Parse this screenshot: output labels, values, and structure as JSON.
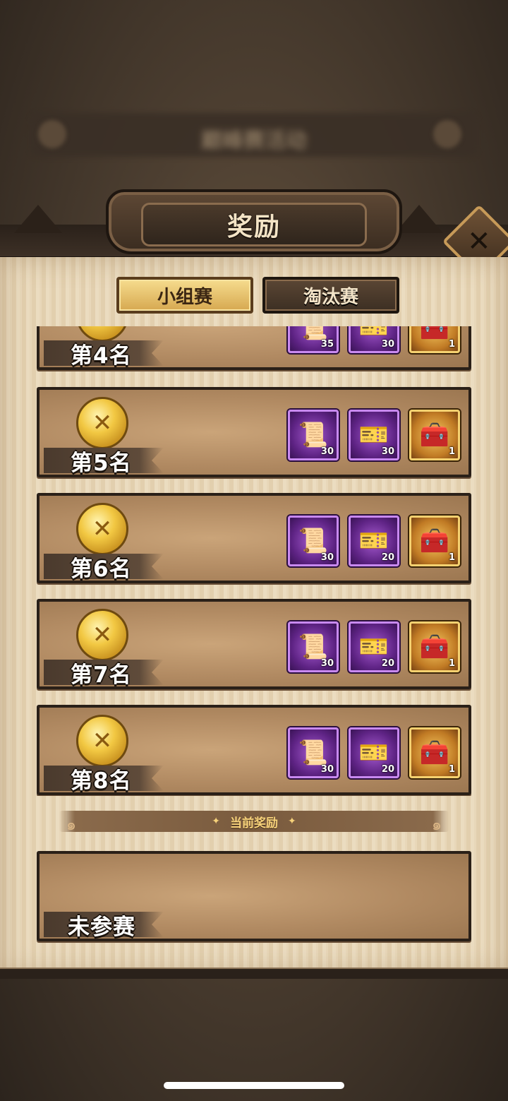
{
  "background": {
    "blurred_title": "巅峰赛活动"
  },
  "header": {
    "title": "奖励"
  },
  "tabs": [
    {
      "label": "小组赛",
      "active": true
    },
    {
      "label": "淘汰赛",
      "active": false
    }
  ],
  "ranks": [
    {
      "label": "第4名",
      "rewards": [
        {
          "type": "purple",
          "icon": "scroll-icon",
          "count": "35"
        },
        {
          "type": "purple",
          "icon": "stamp-icon",
          "count": "30"
        },
        {
          "type": "gold",
          "icon": "chest-icon",
          "count": "1"
        }
      ]
    },
    {
      "label": "第5名",
      "rewards": [
        {
          "type": "purple",
          "icon": "scroll-icon",
          "count": "30"
        },
        {
          "type": "purple",
          "icon": "stamp-icon",
          "count": "30"
        },
        {
          "type": "gold",
          "icon": "chest-icon",
          "count": "1"
        }
      ]
    },
    {
      "label": "第6名",
      "rewards": [
        {
          "type": "purple",
          "icon": "scroll-icon",
          "count": "30"
        },
        {
          "type": "purple",
          "icon": "stamp-icon",
          "count": "20"
        },
        {
          "type": "gold",
          "icon": "chest-icon",
          "count": "1"
        }
      ]
    },
    {
      "label": "第7名",
      "rewards": [
        {
          "type": "purple",
          "icon": "scroll-icon",
          "count": "30"
        },
        {
          "type": "purple",
          "icon": "stamp-icon",
          "count": "20"
        },
        {
          "type": "gold",
          "icon": "chest-icon",
          "count": "1"
        }
      ]
    },
    {
      "label": "第8名",
      "rewards": [
        {
          "type": "purple",
          "icon": "scroll-icon",
          "count": "30"
        },
        {
          "type": "purple",
          "icon": "stamp-icon",
          "count": "20"
        },
        {
          "type": "gold",
          "icon": "chest-icon",
          "count": "1"
        }
      ]
    }
  ],
  "current": {
    "divider_label": "当前奖励",
    "status": "未参赛"
  },
  "colors": {
    "purple_frame": "#c889f0",
    "gold_frame": "#f5d170",
    "panel": "#e8d7b9",
    "accent_text": "#f7d27a"
  }
}
